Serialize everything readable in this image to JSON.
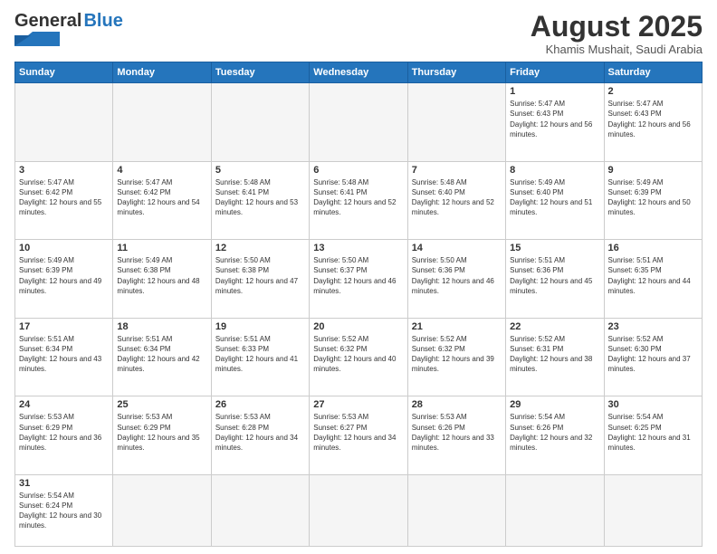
{
  "header": {
    "logo_general": "General",
    "logo_blue": "Blue",
    "month_title": "August 2025",
    "subtitle": "Khamis Mushait, Saudi Arabia"
  },
  "weekdays": [
    "Sunday",
    "Monday",
    "Tuesday",
    "Wednesday",
    "Thursday",
    "Friday",
    "Saturday"
  ],
  "weeks": [
    [
      {
        "day": "",
        "empty": true
      },
      {
        "day": "",
        "empty": true
      },
      {
        "day": "",
        "empty": true
      },
      {
        "day": "",
        "empty": true
      },
      {
        "day": "",
        "empty": true
      },
      {
        "day": "1",
        "sunrise": "5:47 AM",
        "sunset": "6:43 PM",
        "daylight": "12 hours and 56 minutes."
      },
      {
        "day": "2",
        "sunrise": "5:47 AM",
        "sunset": "6:43 PM",
        "daylight": "12 hours and 56 minutes."
      }
    ],
    [
      {
        "day": "3",
        "sunrise": "5:47 AM",
        "sunset": "6:42 PM",
        "daylight": "12 hours and 55 minutes."
      },
      {
        "day": "4",
        "sunrise": "5:47 AM",
        "sunset": "6:42 PM",
        "daylight": "12 hours and 54 minutes."
      },
      {
        "day": "5",
        "sunrise": "5:48 AM",
        "sunset": "6:41 PM",
        "daylight": "12 hours and 53 minutes."
      },
      {
        "day": "6",
        "sunrise": "5:48 AM",
        "sunset": "6:41 PM",
        "daylight": "12 hours and 52 minutes."
      },
      {
        "day": "7",
        "sunrise": "5:48 AM",
        "sunset": "6:40 PM",
        "daylight": "12 hours and 52 minutes."
      },
      {
        "day": "8",
        "sunrise": "5:49 AM",
        "sunset": "6:40 PM",
        "daylight": "12 hours and 51 minutes."
      },
      {
        "day": "9",
        "sunrise": "5:49 AM",
        "sunset": "6:39 PM",
        "daylight": "12 hours and 50 minutes."
      }
    ],
    [
      {
        "day": "10",
        "sunrise": "5:49 AM",
        "sunset": "6:39 PM",
        "daylight": "12 hours and 49 minutes."
      },
      {
        "day": "11",
        "sunrise": "5:49 AM",
        "sunset": "6:38 PM",
        "daylight": "12 hours and 48 minutes."
      },
      {
        "day": "12",
        "sunrise": "5:50 AM",
        "sunset": "6:38 PM",
        "daylight": "12 hours and 47 minutes."
      },
      {
        "day": "13",
        "sunrise": "5:50 AM",
        "sunset": "6:37 PM",
        "daylight": "12 hours and 46 minutes."
      },
      {
        "day": "14",
        "sunrise": "5:50 AM",
        "sunset": "6:36 PM",
        "daylight": "12 hours and 46 minutes."
      },
      {
        "day": "15",
        "sunrise": "5:51 AM",
        "sunset": "6:36 PM",
        "daylight": "12 hours and 45 minutes."
      },
      {
        "day": "16",
        "sunrise": "5:51 AM",
        "sunset": "6:35 PM",
        "daylight": "12 hours and 44 minutes."
      }
    ],
    [
      {
        "day": "17",
        "sunrise": "5:51 AM",
        "sunset": "6:34 PM",
        "daylight": "12 hours and 43 minutes."
      },
      {
        "day": "18",
        "sunrise": "5:51 AM",
        "sunset": "6:34 PM",
        "daylight": "12 hours and 42 minutes."
      },
      {
        "day": "19",
        "sunrise": "5:51 AM",
        "sunset": "6:33 PM",
        "daylight": "12 hours and 41 minutes."
      },
      {
        "day": "20",
        "sunrise": "5:52 AM",
        "sunset": "6:32 PM",
        "daylight": "12 hours and 40 minutes."
      },
      {
        "day": "21",
        "sunrise": "5:52 AM",
        "sunset": "6:32 PM",
        "daylight": "12 hours and 39 minutes."
      },
      {
        "day": "22",
        "sunrise": "5:52 AM",
        "sunset": "6:31 PM",
        "daylight": "12 hours and 38 minutes."
      },
      {
        "day": "23",
        "sunrise": "5:52 AM",
        "sunset": "6:30 PM",
        "daylight": "12 hours and 37 minutes."
      }
    ],
    [
      {
        "day": "24",
        "sunrise": "5:53 AM",
        "sunset": "6:29 PM",
        "daylight": "12 hours and 36 minutes."
      },
      {
        "day": "25",
        "sunrise": "5:53 AM",
        "sunset": "6:29 PM",
        "daylight": "12 hours and 35 minutes."
      },
      {
        "day": "26",
        "sunrise": "5:53 AM",
        "sunset": "6:28 PM",
        "daylight": "12 hours and 34 minutes."
      },
      {
        "day": "27",
        "sunrise": "5:53 AM",
        "sunset": "6:27 PM",
        "daylight": "12 hours and 34 minutes."
      },
      {
        "day": "28",
        "sunrise": "5:53 AM",
        "sunset": "6:26 PM",
        "daylight": "12 hours and 33 minutes."
      },
      {
        "day": "29",
        "sunrise": "5:54 AM",
        "sunset": "6:26 PM",
        "daylight": "12 hours and 32 minutes."
      },
      {
        "day": "30",
        "sunrise": "5:54 AM",
        "sunset": "6:25 PM",
        "daylight": "12 hours and 31 minutes."
      }
    ],
    [
      {
        "day": "31",
        "sunrise": "5:54 AM",
        "sunset": "6:24 PM",
        "daylight": "12 hours and 30 minutes."
      },
      {
        "day": "",
        "empty": true
      },
      {
        "day": "",
        "empty": true
      },
      {
        "day": "",
        "empty": true
      },
      {
        "day": "",
        "empty": true
      },
      {
        "day": "",
        "empty": true
      },
      {
        "day": "",
        "empty": true
      }
    ]
  ]
}
